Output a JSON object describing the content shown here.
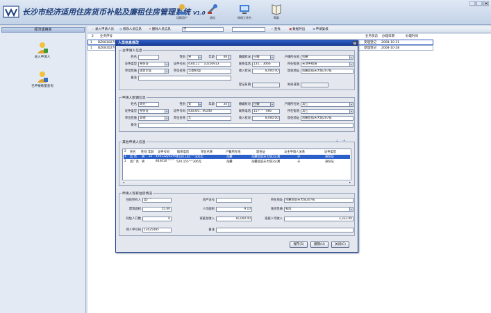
{
  "app": {
    "title": "长沙市经济适用住房货币补贴及廉租住房管理系统",
    "version": "V1.0"
  },
  "toolbar_main": [
    {
      "label": "切换用户",
      "icon": "user-switch-icon"
    },
    {
      "label": "退出",
      "icon": "exit-icon"
    },
    {
      "label": "修改工作台",
      "icon": "workbench-icon"
    },
    {
      "label": "帮助",
      "icon": "help-book-icon"
    }
  ],
  "sidebar": {
    "header": "经济适用房",
    "items": [
      {
        "label": "录入申请人"
      },
      {
        "label": "已申报数量查询"
      }
    ]
  },
  "list_toolbar": {
    "add": "录入申请人员",
    "edit": "修改人员信息",
    "delete": "删除人员信息",
    "filter_value": "否",
    "query": "查找",
    "export": "数据导出",
    "submit": "申请复核"
  },
  "grid": {
    "headers_left": [
      "业务序号"
    ],
    "headers_right": [
      "业务状态",
      "办理日期",
      "办理时间"
    ],
    "rows": [
      {
        "no": "1",
        "id": "BZ0810270",
        "flag": "00",
        "status": "受理登记",
        "date": "2008-10-31"
      },
      {
        "no": "1",
        "id": "BZ0810270",
        "flag": "00",
        "status": "受理登记",
        "date": "2008-10-28"
      }
    ]
  },
  "dialog": {
    "title": "人员信息修改",
    "close": "×",
    "sec_main": "主申请人信息",
    "sec_spouse": "申请人配偶信息",
    "sec_other": "其他申请人信息",
    "sec_housing": "申请人现有住房情况",
    "labels": {
      "name": "姓名",
      "gender": "性别",
      "age": "年龄",
      "marital": "婚姻状况",
      "hukou": "户籍所在地",
      "id_type": "证件类型",
      "id_no": "证件号码",
      "phone": "联系电话",
      "district": "所在街道",
      "unit_type": "单位性质",
      "unit_name": "单位名称",
      "income": "收入状况",
      "address": "现住地址",
      "remark": "备注",
      "reg_date": "登记日期",
      "unregister_date": "失效日期",
      "owner": "住房所有人",
      "cert_no": "房产证号",
      "house_addr": "所在地址",
      "area": "建筑面积",
      "per_area": "人均面积",
      "struct": "住房性质",
      "family_count": "同住人口数",
      "family_income": "家庭总收入",
      "per_income": "家庭人均收入",
      "apply_no": "领人申号码",
      "note": "备注"
    },
    "main": {
      "name": "",
      "gender": "男",
      "age": "48",
      "marital": "已婚",
      "hukou": "岳麓",
      "id_type": "身份证",
      "id_no": "430111'''' 10256913",
      "phone": "135...  3066",
      "district": "天顶乡街道",
      "unit_type": "国营企业",
      "unit_name": "华菱机电厂",
      "income": "8,000.00",
      "address": "岳麓区航天大院207栋",
      "remark": "",
      "reg_date": "",
      "unregister_date": ""
    },
    "spouse": {
      "name": "周宪''",
      "gender": "女",
      "age": "34",
      "marital": "已婚",
      "hukou": "其它",
      "id_type": "身份证",
      "id_no": "430305..      40240",
      "phone": "157''''' ''066",
      "district": "其它",
      "unit_type": "其他",
      "unit_name": "无",
      "income": "8,000.00",
      "address": "岳麓区航天大院207栋",
      "remark": ""
    },
    "other": {
      "headers": [
        "姓名",
        "性别",
        "年龄",
        "证件号码",
        "联系电话",
        "单位名称",
        "户籍所在地",
        "现住址",
        "与主申请人关系",
        "证件类型"
      ],
      "rows": [
        {
          "no": "1",
          "name": "高   然",
          "gender": "男",
          "age": "22",
          "id_no": "430112ya1997",
          "phone": "8100.185'''''306无",
          "hukou": "岳麓",
          "address": "岳麓区航天大院2公寓",
          "relation": "子",
          "type": "身份证"
        },
        {
          "no": "2",
          "name": "高广亮",
          "gender": "男",
          "age": "",
          "id_no": "843010'''''''''",
          "phone": "520.155'''''306无",
          "hukou": "岳麓",
          "address": "岳麓区航天大院2公寓",
          "relation": "子",
          "type": "身份证"
        }
      ]
    },
    "housing": {
      "owner": "高广''",
      "cert_no": "",
      "house_addr": "岳麓区航天大院207栋",
      "area": "55.00",
      "per_area": "9.10",
      "struct": "私房",
      "family_count": "6",
      "family_income": "16,000.00",
      "per_income": "3,333.00",
      "apply_no": "13025485",
      "note": ""
    },
    "buttons": {
      "save": "保存(S)",
      "cancel": "撤销(U)",
      "close": "关闭(C)"
    }
  }
}
